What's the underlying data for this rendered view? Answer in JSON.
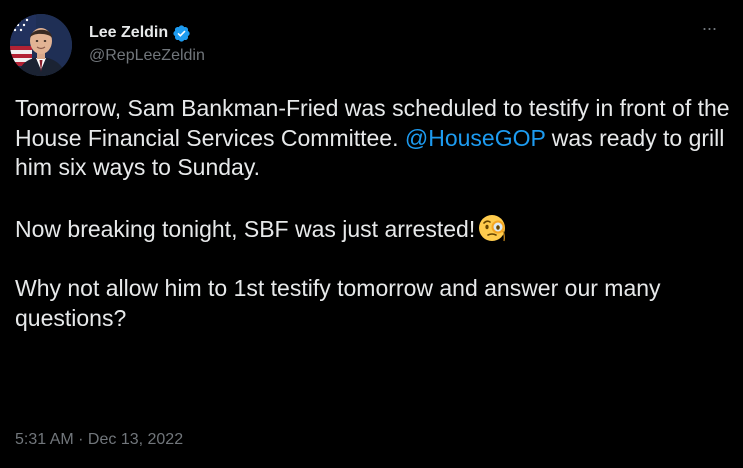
{
  "author": {
    "display_name": "Lee Zeldin",
    "handle": "@RepLeeZeldin",
    "verified": true
  },
  "tweet": {
    "paragraph1": {
      "before_mention": "Tomorrow, Sam Bankman-Fried was scheduled to testify in front of the House Financial Services Committee. ",
      "mention": "@HouseGOP",
      "after_mention": " was ready to grill him six ways to Sunday."
    },
    "paragraph2": "Now breaking tonight, SBF was just arrested!",
    "paragraph2_emoji": "face-with-monocle-emoji",
    "paragraph3": "Why not allow him to 1st testify tomorrow and answer our many questions?"
  },
  "meta": {
    "time": "5:31 AM",
    "separator": " · ",
    "date": "Dec 13, 2022"
  },
  "more_menu": {
    "label": "···"
  },
  "colors": {
    "background": "#000000",
    "text": "#e7e9ea",
    "secondary": "#71767b",
    "accent": "#1d9bf0"
  }
}
